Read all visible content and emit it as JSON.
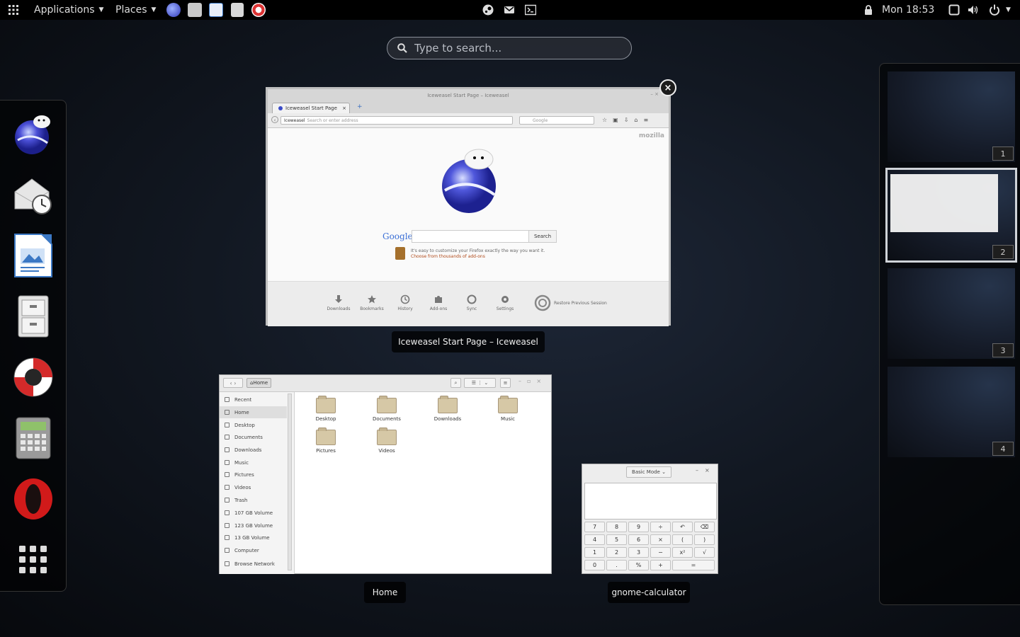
{
  "topbar": {
    "applications_label": "Applications",
    "places_label": "Places",
    "clock": "Mon 18:53"
  },
  "search": {
    "placeholder": "Type to search..."
  },
  "dash": {
    "items": [
      "iceweasel-icon",
      "evolution-mail-icon",
      "libreoffice-impress-icon",
      "file-cabinet-icon",
      "help-lifebuoy-icon",
      "calculator-icon",
      "opera-icon",
      "show-applications-icon"
    ]
  },
  "workspaces": {
    "items": [
      "1",
      "2",
      "3",
      "4"
    ],
    "active": "2"
  },
  "windows": {
    "browser": {
      "caption": "Iceweasel Start Page – Iceweasel",
      "title": "Iceweasel Start Page – Iceweasel",
      "tab_label": "Iceweasel Start Page",
      "url_prefix": "Iceweasel",
      "url_placeholder": "Search or enter address",
      "search_engine": "Google",
      "brand": "mozilla",
      "google_logo": "Google",
      "search_button": "Search",
      "tip_text": "It's easy to customize your Firefox exactly the way you want it.",
      "tip_link": "Choose from thousands of add-ons",
      "launcher": [
        "Downloads",
        "Bookmarks",
        "History",
        "Add-ons",
        "Sync",
        "Settings"
      ],
      "restore": "Restore Previous Session"
    },
    "files": {
      "caption": "Home",
      "path": "Home",
      "sidebar": [
        "Recent",
        "Home",
        "Desktop",
        "Documents",
        "Downloads",
        "Music",
        "Pictures",
        "Videos",
        "Trash",
        "107 GB Volume",
        "123 GB Volume",
        "13 GB Volume",
        "Computer",
        "Browse Network"
      ],
      "folders": [
        "Desktop",
        "Documents",
        "Downloads",
        "Music",
        "Pictures",
        "Videos"
      ]
    },
    "calculator": {
      "caption": "gnome-calculator",
      "mode": "Basic Mode",
      "keys": [
        "7",
        "8",
        "9",
        "÷",
        "↶",
        "⌫",
        "4",
        "5",
        "6",
        "×",
        "(",
        ")",
        "1",
        "2",
        "3",
        "−",
        "x²",
        "√",
        "0",
        ".",
        "%",
        "+",
        "="
      ]
    }
  }
}
